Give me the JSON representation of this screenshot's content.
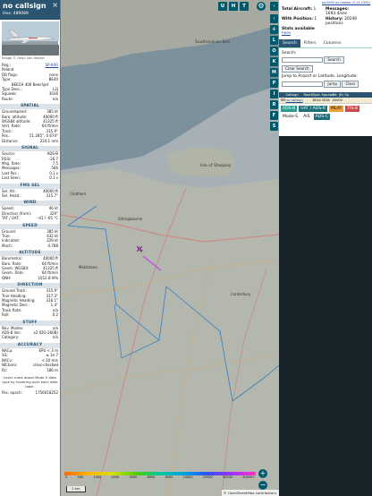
{
  "left": {
    "title": "no callsign",
    "hex_label": "Hex:",
    "hex": "489089",
    "close_icon": "×",
    "photo_credit": "Image © Dean van Hoesel",
    "info": [
      {
        "k": "Reg.:",
        "v": "SP-KAR",
        "link": true
      },
      {
        "k": "",
        "v": "Poland"
      },
      {
        "k": "DB flags:",
        "v": "none"
      },
      {
        "k": "Type:",
        "v": "BE40"
      },
      {
        "k": "",
        "v": "BEECH 400 Beechjet",
        "center": true
      },
      {
        "k": "Type Desc.:",
        "v": "L2J"
      },
      {
        "k": "Squawk:",
        "v": "3036"
      },
      {
        "k": "Route:",
        "v": "n/a"
      }
    ],
    "sections": [
      {
        "title": "SPATIAL",
        "rows": [
          {
            "k": "Groundspeed:",
            "v": "385 kt"
          },
          {
            "k": "Baro. altitude:",
            "v": "40000 ft"
          },
          {
            "k": "WGS84 altitude:",
            "v": "41325 ft"
          },
          {
            "k": "Vert. Rate:",
            "v": "64 ft/min"
          },
          {
            "k": "Track:",
            "v": "315.9°"
          },
          {
            "k": "Pos.:",
            "v": "51.285°, 0.674°"
          },
          {
            "k": "Distance:",
            "v": "224.1 nmi"
          }
        ]
      },
      {
        "title": "SIGNAL",
        "rows": [
          {
            "k": "Source:",
            "v": "ADS-B"
          },
          {
            "k": "RSSI:",
            "v": "-26.7"
          },
          {
            "k": "Msg. Rate:",
            "v": "7.5"
          },
          {
            "k": "Messages:",
            "v": "566"
          },
          {
            "k": "Last Pos.:",
            "v": "0.1 s"
          },
          {
            "k": "Last Seen:",
            "v": "0.1 s"
          }
        ]
      },
      {
        "title": "FMS SEL",
        "rows": [
          {
            "k": "Sel. Alt.:",
            "v": "40000 ft"
          },
          {
            "k": "Sel. Head.:",
            "v": "315.7°"
          }
        ]
      },
      {
        "title": "WIND",
        "rows": [
          {
            "k": "Speed:",
            "v": "46 kt"
          },
          {
            "k": "Direction (from):",
            "v": "329°"
          },
          {
            "k": "TAT / OAT:",
            "v": "-41 / -65 °C"
          }
        ]
      },
      {
        "title": "SPEED",
        "rows": [
          {
            "k": "Ground:",
            "v": "385 kt"
          },
          {
            "k": "True:",
            "v": "432 kt"
          },
          {
            "k": "Indicated:",
            "v": "229 kt"
          },
          {
            "k": "Mach:",
            "v": "0.788"
          }
        ]
      },
      {
        "title": "ALTITUDE",
        "rows": [
          {
            "k": "Barometric:",
            "v": "40000 ft"
          },
          {
            "k": "Baro. Rate:",
            "v": "64 ft/min"
          },
          {
            "k": "Geom. WGS84:",
            "v": "41325 ft"
          },
          {
            "k": "Geom. Rate:",
            "v": "64 ft/min"
          },
          {
            "k": "QNH:",
            "v": "1012.8 hPa"
          }
        ]
      },
      {
        "title": "DIRECTION",
        "rows": [
          {
            "k": "Ground Track:",
            "v": "315.9°"
          },
          {
            "k": "True Heading:",
            "v": "317.3°"
          },
          {
            "k": "Magnetic Heading:",
            "v": "316.1°"
          },
          {
            "k": "Magnetic Decl.:",
            "v": "1.4°"
          },
          {
            "k": "Track Rate:",
            "v": "n/a"
          },
          {
            "k": "Roll:",
            "v": "0.2"
          }
        ]
      },
      {
        "title": "STUFF",
        "rows": [
          {
            "k": "Nav. Modes:",
            "v": "n/a"
          },
          {
            "k": "ADS-B Ver.:",
            "v": "v2 (DO-260B)"
          },
          {
            "k": "Category:",
            "v": "n/a"
          }
        ]
      },
      {
        "title": "ACCURACY",
        "rows": [
          {
            "k": "NACp:",
            "v": "EPU < 3 m"
          },
          {
            "k": "SIL:",
            "v": "≤ 1e-7"
          },
          {
            "k": "NACv:",
            "v": "< 10 m/s"
          },
          {
            "k": "NICbaro:",
            "v": "cross-checked"
          },
          {
            "k": "Rc:",
            "v": "186 m"
          }
        ]
      }
    ],
    "note": "Learn more about Mode S data type by hovering over each data label.",
    "footer_k": "Pos. epoch:",
    "footer_v": "1756018252"
  },
  "map": {
    "top_buttons": [
      "U",
      "H",
      "T"
    ],
    "side_buttons": [
      "L",
      "O",
      "K",
      "M",
      "P",
      "I",
      "R",
      "F",
      "S"
    ],
    "colorbar_ticks": [
      "0",
      "500",
      "1000",
      "2000",
      "4000",
      "6000",
      "8000",
      "10000",
      "20000",
      "30000",
      "40000+"
    ],
    "scale": "2 km",
    "attribution": "© OpenStreetMap contributors.",
    "zoom_in": "+",
    "zoom_out": "−",
    "place_labels": [
      "Isle of Sheppey",
      "Southend-on-Sea",
      "Sittingbourne",
      "Maidstone",
      "Chatham",
      "Canterbury"
    ]
  },
  "right": {
    "version": "tar1090 on readsb (3.14.1592)",
    "stats": {
      "total_label": "Total Aircraft:",
      "total": "1",
      "messages_label": "Messages:",
      "messages": "1693.4/sec",
      "position_label": "With Position:",
      "position": "1",
      "history_label": "History:",
      "history": "20246 positions",
      "stats_label": "Stats available",
      "stats_link": "here"
    },
    "tabs": [
      "Search",
      "Filters",
      "Columns"
    ],
    "search_label": "Search:",
    "search_btn": "Search",
    "clear_search": "Clear Search",
    "jump_label": "Jump to Airport or Latitude, Longitude:",
    "jump_btn": "Jump",
    "clear_btn": "Clear",
    "table_headers": [
      "",
      "Callsign",
      "Route",
      "Type",
      "Squawk",
      "Alt. (ft)",
      "Sp"
    ],
    "table_rows": [
      {
        "callsign": "no callsign",
        "route": "",
        "type": "BE40",
        "squawk": "3036",
        "alt": "40000"
      }
    ],
    "badges": [
      "ADS-B",
      "UAT / ADS-R",
      "MLAT",
      "TIS-B",
      "Mode-S",
      "AIS",
      "ADS-C"
    ]
  }
}
